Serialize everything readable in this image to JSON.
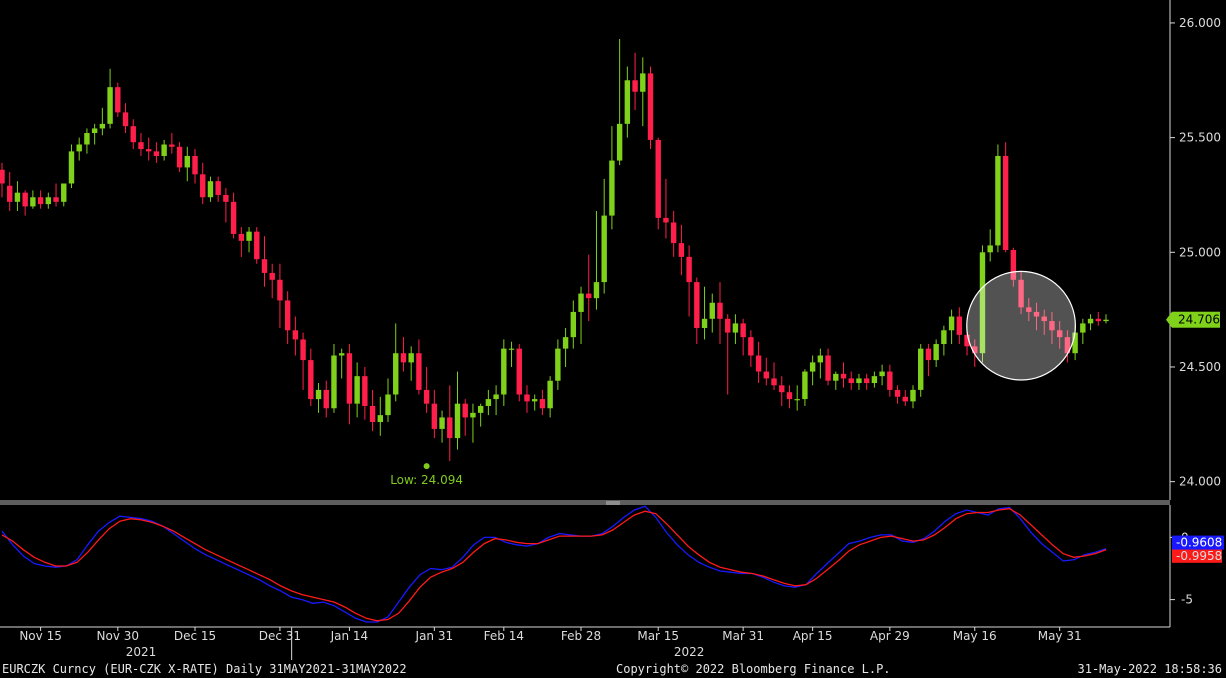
{
  "colors": {
    "up": "#7fd11a",
    "down": "#ff1f4a",
    "grid": "#2a2a2a",
    "axis": "#d8d8d8",
    "panel_divider": "#6e6e6e",
    "macd": "#1919ff",
    "signal": "#ff1a1a",
    "last_price_tag_bg": "#7fd11a",
    "macd_tag_bg": "#1919ff",
    "signal_tag_bg": "#ff1a1a"
  },
  "footer": {
    "security": "EURCZK Curncy (EUR-CZK X-RATE)  Daily 31MAY2021-31MAY2022",
    "copyright": "Copyright© 2022 Bloomberg Finance L.P.",
    "timestamp": "31-May-2022 18:58:36"
  },
  "chart_data": [
    {
      "type": "candlestick",
      "title": "",
      "ylim": [
        23.92,
        26.1
      ],
      "y_ticks": [
        "26.000",
        "25.500",
        "25.000",
        "24.500",
        "24.000"
      ],
      "y_tick_values": [
        26.0,
        25.5,
        25.0,
        24.5,
        24.0
      ],
      "last_price_label": "24.706",
      "last_price": 24.706,
      "low_annotation": {
        "text": "Low: 24.094",
        "value": 24.094,
        "date_index": 55
      },
      "highlight_circle": {
        "from_index": 126,
        "to_index": 138,
        "center_value": 24.68
      },
      "x_ticks": [
        {
          "label": "Nov 15",
          "index": 5
        },
        {
          "label": "Nov 30",
          "index": 15
        },
        {
          "label": "Dec 15",
          "index": 25
        },
        {
          "label": "Dec 31",
          "index": 36
        },
        {
          "label": "Jan 14",
          "index": 45
        },
        {
          "label": "Jan 31",
          "index": 56
        },
        {
          "label": "Feb 14",
          "index": 65
        },
        {
          "label": "Feb 28",
          "index": 75
        },
        {
          "label": "Mar 15",
          "index": 85
        },
        {
          "label": "Mar 31",
          "index": 96
        },
        {
          "label": "Apr 15",
          "index": 105
        },
        {
          "label": "Apr 29",
          "index": 115
        },
        {
          "label": "May 16",
          "index": 126
        },
        {
          "label": "May 31",
          "index": 137
        }
      ],
      "year_labels": [
        {
          "label": "2021",
          "index": 18
        },
        {
          "label": "2022",
          "index": 89
        }
      ],
      "year_separator_index": 37,
      "grid": false,
      "ohlc": [
        [
          25.36,
          25.39,
          25.24,
          25.3
        ],
        [
          25.29,
          25.35,
          25.18,
          25.22
        ],
        [
          25.22,
          25.31,
          25.18,
          25.26
        ],
        [
          25.26,
          25.27,
          25.16,
          25.2
        ],
        [
          25.2,
          25.27,
          25.19,
          25.24
        ],
        [
          25.24,
          25.27,
          25.19,
          25.21
        ],
        [
          25.21,
          25.26,
          25.19,
          25.24
        ],
        [
          25.24,
          25.3,
          25.2,
          25.22
        ],
        [
          25.22,
          25.3,
          25.2,
          25.3
        ],
        [
          25.3,
          25.47,
          25.28,
          25.44
        ],
        [
          25.44,
          25.5,
          25.4,
          25.47
        ],
        [
          25.47,
          25.54,
          25.43,
          25.52
        ],
        [
          25.52,
          25.56,
          25.47,
          25.54
        ],
        [
          25.54,
          25.63,
          25.51,
          25.56
        ],
        [
          25.56,
          25.8,
          25.54,
          25.72
        ],
        [
          25.72,
          25.74,
          25.59,
          25.61
        ],
        [
          25.61,
          25.65,
          25.52,
          25.55
        ],
        [
          25.55,
          25.58,
          25.45,
          25.48
        ],
        [
          25.48,
          25.52,
          25.42,
          25.45
        ],
        [
          25.45,
          25.5,
          25.4,
          25.44
        ],
        [
          25.44,
          25.48,
          25.39,
          25.42
        ],
        [
          25.42,
          25.49,
          25.4,
          25.47
        ],
        [
          25.47,
          25.52,
          25.43,
          25.46
        ],
        [
          25.46,
          25.48,
          25.35,
          25.37
        ],
        [
          25.37,
          25.46,
          25.31,
          25.42
        ],
        [
          25.42,
          25.45,
          25.3,
          25.34
        ],
        [
          25.34,
          25.39,
          25.21,
          25.24
        ],
        [
          25.24,
          25.33,
          25.22,
          25.31
        ],
        [
          25.31,
          25.33,
          25.22,
          25.25
        ],
        [
          25.25,
          25.28,
          25.13,
          25.22
        ],
        [
          25.22,
          25.26,
          25.06,
          25.08
        ],
        [
          25.08,
          25.11,
          24.98,
          25.05
        ],
        [
          25.05,
          25.11,
          25.0,
          25.09
        ],
        [
          25.09,
          25.11,
          24.95,
          24.97
        ],
        [
          24.97,
          25.07,
          24.85,
          24.91
        ],
        [
          24.91,
          24.95,
          24.8,
          24.88
        ],
        [
          24.88,
          24.95,
          24.67,
          24.79
        ],
        [
          24.79,
          24.83,
          24.6,
          24.66
        ],
        [
          24.66,
          24.72,
          24.55,
          24.62
        ],
        [
          24.62,
          24.65,
          24.4,
          24.53
        ],
        [
          24.53,
          24.58,
          24.33,
          24.36
        ],
        [
          24.36,
          24.43,
          24.3,
          24.4
        ],
        [
          24.4,
          24.44,
          24.28,
          24.32
        ],
        [
          24.32,
          24.6,
          24.3,
          24.55
        ],
        [
          24.55,
          24.58,
          24.45,
          24.56
        ],
        [
          24.56,
          24.6,
          24.25,
          24.34
        ],
        [
          24.34,
          24.52,
          24.28,
          24.46
        ],
        [
          24.46,
          24.5,
          24.27,
          24.33
        ],
        [
          24.33,
          24.4,
          24.22,
          24.26
        ],
        [
          24.26,
          24.37,
          24.2,
          24.29
        ],
        [
          24.29,
          24.45,
          24.26,
          24.38
        ],
        [
          24.38,
          24.69,
          24.35,
          24.56
        ],
        [
          24.56,
          24.63,
          24.48,
          24.52
        ],
        [
          24.52,
          24.59,
          24.44,
          24.56
        ],
        [
          24.56,
          24.62,
          24.38,
          24.4
        ],
        [
          24.4,
          24.5,
          24.3,
          24.34
        ],
        [
          24.34,
          24.4,
          24.19,
          24.23
        ],
        [
          24.23,
          24.31,
          24.17,
          24.28
        ],
        [
          24.28,
          24.42,
          24.09,
          24.19
        ],
        [
          24.19,
          24.48,
          24.14,
          24.34
        ],
        [
          24.34,
          24.36,
          24.2,
          24.28
        ],
        [
          24.28,
          24.34,
          24.17,
          24.3
        ],
        [
          24.3,
          24.34,
          24.24,
          24.33
        ],
        [
          24.33,
          24.4,
          24.29,
          24.36
        ],
        [
          24.36,
          24.42,
          24.29,
          24.38
        ],
        [
          24.38,
          24.62,
          24.33,
          24.58
        ],
        [
          24.58,
          24.61,
          24.5,
          24.58
        ],
        [
          24.58,
          24.6,
          24.35,
          24.38
        ],
        [
          24.38,
          24.42,
          24.3,
          24.35
        ],
        [
          24.35,
          24.38,
          24.31,
          24.36
        ],
        [
          24.36,
          24.4,
          24.29,
          24.32
        ],
        [
          24.32,
          24.46,
          24.28,
          24.44
        ],
        [
          24.44,
          24.62,
          24.4,
          24.58
        ],
        [
          24.58,
          24.67,
          24.5,
          24.63
        ],
        [
          24.63,
          24.79,
          24.58,
          24.74
        ],
        [
          24.74,
          24.85,
          24.6,
          24.82
        ],
        [
          24.82,
          24.99,
          24.7,
          24.8
        ],
        [
          24.8,
          25.18,
          24.75,
          24.87
        ],
        [
          24.87,
          25.32,
          24.82,
          25.16
        ],
        [
          25.16,
          25.55,
          25.1,
          25.4
        ],
        [
          25.4,
          25.93,
          25.38,
          25.56
        ],
        [
          25.56,
          25.81,
          25.5,
          25.75
        ],
        [
          25.75,
          25.87,
          25.62,
          25.7
        ],
        [
          25.7,
          25.85,
          25.55,
          25.78
        ],
        [
          25.78,
          25.81,
          25.45,
          25.49
        ],
        [
          25.49,
          25.5,
          25.1,
          25.15
        ],
        [
          25.15,
          25.32,
          25.06,
          25.13
        ],
        [
          25.13,
          25.18,
          24.98,
          25.04
        ],
        [
          25.04,
          25.12,
          24.9,
          24.98
        ],
        [
          24.98,
          25.03,
          24.72,
          24.87
        ],
        [
          24.87,
          24.89,
          24.6,
          24.67
        ],
        [
          24.67,
          24.85,
          24.62,
          24.71
        ],
        [
          24.71,
          24.82,
          24.65,
          24.78
        ],
        [
          24.78,
          24.87,
          24.6,
          24.71
        ],
        [
          24.71,
          24.73,
          24.38,
          24.65
        ],
        [
          24.65,
          24.73,
          24.6,
          24.69
        ],
        [
          24.69,
          24.71,
          24.55,
          24.63
        ],
        [
          24.63,
          24.66,
          24.5,
          24.55
        ],
        [
          24.55,
          24.61,
          24.43,
          24.48
        ],
        [
          24.48,
          24.54,
          24.42,
          24.45
        ],
        [
          24.45,
          24.52,
          24.4,
          24.42
        ],
        [
          24.42,
          24.46,
          24.33,
          24.39
        ],
        [
          24.39,
          24.42,
          24.32,
          24.36
        ],
        [
          24.36,
          24.42,
          24.31,
          24.36
        ],
        [
          24.36,
          24.49,
          24.33,
          24.48
        ],
        [
          24.48,
          24.55,
          24.42,
          24.52
        ],
        [
          24.52,
          24.58,
          24.45,
          24.55
        ],
        [
          24.55,
          24.58,
          24.42,
          24.44
        ],
        [
          24.44,
          24.48,
          24.4,
          24.47
        ],
        [
          24.47,
          24.52,
          24.41,
          24.45
        ],
        [
          24.45,
          24.48,
          24.4,
          24.43
        ],
        [
          24.43,
          24.47,
          24.4,
          24.45
        ],
        [
          24.45,
          24.47,
          24.4,
          24.43
        ],
        [
          24.43,
          24.48,
          24.41,
          24.46
        ],
        [
          24.46,
          24.51,
          24.42,
          24.48
        ],
        [
          24.48,
          24.51,
          24.37,
          24.4
        ],
        [
          24.4,
          24.42,
          24.34,
          24.37
        ],
        [
          24.37,
          24.4,
          24.33,
          24.35
        ],
        [
          24.35,
          24.42,
          24.32,
          24.4
        ],
        [
          24.4,
          24.6,
          24.37,
          24.58
        ],
        [
          24.58,
          24.6,
          24.46,
          24.53
        ],
        [
          24.53,
          24.62,
          24.5,
          24.6
        ],
        [
          24.6,
          24.68,
          24.55,
          24.66
        ],
        [
          24.66,
          24.75,
          24.6,
          24.72
        ],
        [
          24.72,
          24.76,
          24.6,
          24.64
        ],
        [
          24.64,
          24.68,
          24.55,
          24.59
        ],
        [
          24.59,
          24.62,
          24.5,
          24.56
        ],
        [
          24.56,
          25.03,
          24.52,
          25.0
        ],
        [
          25.0,
          25.1,
          24.96,
          25.03
        ],
        [
          25.03,
          25.47,
          25.0,
          25.42
        ],
        [
          25.42,
          25.48,
          25.0,
          25.01
        ],
        [
          25.01,
          25.02,
          24.85,
          24.88
        ],
        [
          24.88,
          24.92,
          24.73,
          24.76
        ],
        [
          24.76,
          24.8,
          24.7,
          24.74
        ],
        [
          24.74,
          24.78,
          24.66,
          24.72
        ],
        [
          24.72,
          24.75,
          24.64,
          24.7
        ],
        [
          24.7,
          24.74,
          24.6,
          24.66
        ],
        [
          24.66,
          24.7,
          24.58,
          24.63
        ],
        [
          24.63,
          24.66,
          24.52,
          24.56
        ],
        [
          24.56,
          24.68,
          24.53,
          24.65
        ],
        [
          24.65,
          24.71,
          24.6,
          24.69
        ],
        [
          24.69,
          24.73,
          24.66,
          24.71
        ],
        [
          24.71,
          24.74,
          24.68,
          24.7
        ],
        [
          24.7,
          24.73,
          24.69,
          24.706
        ]
      ]
    },
    {
      "type": "line",
      "title": "",
      "ylim": [
        -7.2,
        2.6
      ],
      "y_ticks": [
        "0",
        "-5"
      ],
      "y_tick_values": [
        0,
        -5
      ],
      "macd_label": "-0.9608",
      "signal_label": "-0.9958",
      "series": [
        {
          "color": "#1919ff",
          "values": [
            0.5,
            -0.6,
            -1.5,
            -2.1,
            -2.3,
            -2.4,
            -2.3,
            -1.8,
            -0.6,
            0.5,
            1.2,
            1.7,
            1.6,
            1.5,
            1.3,
            0.9,
            0.3,
            -0.3,
            -0.9,
            -1.4,
            -1.8,
            -2.2,
            -2.6,
            -3.0,
            -3.4,
            -3.9,
            -4.3,
            -4.8,
            -5.0,
            -5.3,
            -5.2,
            -5.5,
            -6.0,
            -6.5,
            -6.8,
            -6.8,
            -6.4,
            -5.2,
            -4.0,
            -3.0,
            -2.5,
            -2.6,
            -2.4,
            -1.6,
            -0.6,
            0.0,
            0.0,
            -0.4,
            -0.6,
            -0.7,
            -0.5,
            0.0,
            0.3,
            0.2,
            0.1,
            0.1,
            0.3,
            0.9,
            1.6,
            2.2,
            2.5,
            1.6,
            0.4,
            -0.6,
            -1.4,
            -2.0,
            -2.4,
            -2.7,
            -2.8,
            -2.9,
            -2.9,
            -3.2,
            -3.6,
            -3.9,
            -4.0,
            -3.8,
            -2.9,
            -2.1,
            -1.3,
            -0.5,
            -0.3,
            0.0,
            0.2,
            0.2,
            -0.3,
            -0.4,
            -0.1,
            0.5,
            1.3,
            1.9,
            2.2,
            2.0,
            1.8,
            2.3,
            2.4,
            1.5,
            0.4,
            -0.5,
            -1.2,
            -1.9,
            -1.8,
            -1.4,
            -1.2,
            -0.9
          ]
        },
        {
          "color": "#ff1a1a",
          "values": [
            0.2,
            -0.3,
            -1.0,
            -1.6,
            -2.0,
            -2.3,
            -2.3,
            -2.0,
            -1.2,
            -0.2,
            0.7,
            1.3,
            1.5,
            1.4,
            1.2,
            0.9,
            0.5,
            0.0,
            -0.5,
            -1.0,
            -1.4,
            -1.8,
            -2.2,
            -2.6,
            -3.0,
            -3.4,
            -3.9,
            -4.3,
            -4.6,
            -4.8,
            -5.0,
            -5.2,
            -5.6,
            -6.1,
            -6.5,
            -6.7,
            -6.6,
            -6.1,
            -5.1,
            -4.0,
            -3.2,
            -2.8,
            -2.5,
            -2.0,
            -1.2,
            -0.5,
            -0.1,
            -0.2,
            -0.4,
            -0.5,
            -0.5,
            -0.2,
            0.1,
            0.1,
            0.1,
            0.1,
            0.2,
            0.6,
            1.2,
            1.8,
            2.1,
            1.9,
            1.1,
            0.2,
            -0.7,
            -1.4,
            -2.0,
            -2.4,
            -2.6,
            -2.8,
            -2.9,
            -3.1,
            -3.4,
            -3.7,
            -3.9,
            -3.8,
            -3.3,
            -2.6,
            -1.9,
            -1.1,
            -0.6,
            -0.3,
            0.0,
            0.1,
            -0.1,
            -0.3,
            -0.2,
            0.2,
            0.8,
            1.5,
            1.9,
            2.0,
            2.0,
            2.2,
            2.3,
            1.8,
            1.0,
            0.2,
            -0.6,
            -1.3,
            -1.6,
            -1.5,
            -1.3,
            -1.0
          ]
        }
      ]
    }
  ]
}
